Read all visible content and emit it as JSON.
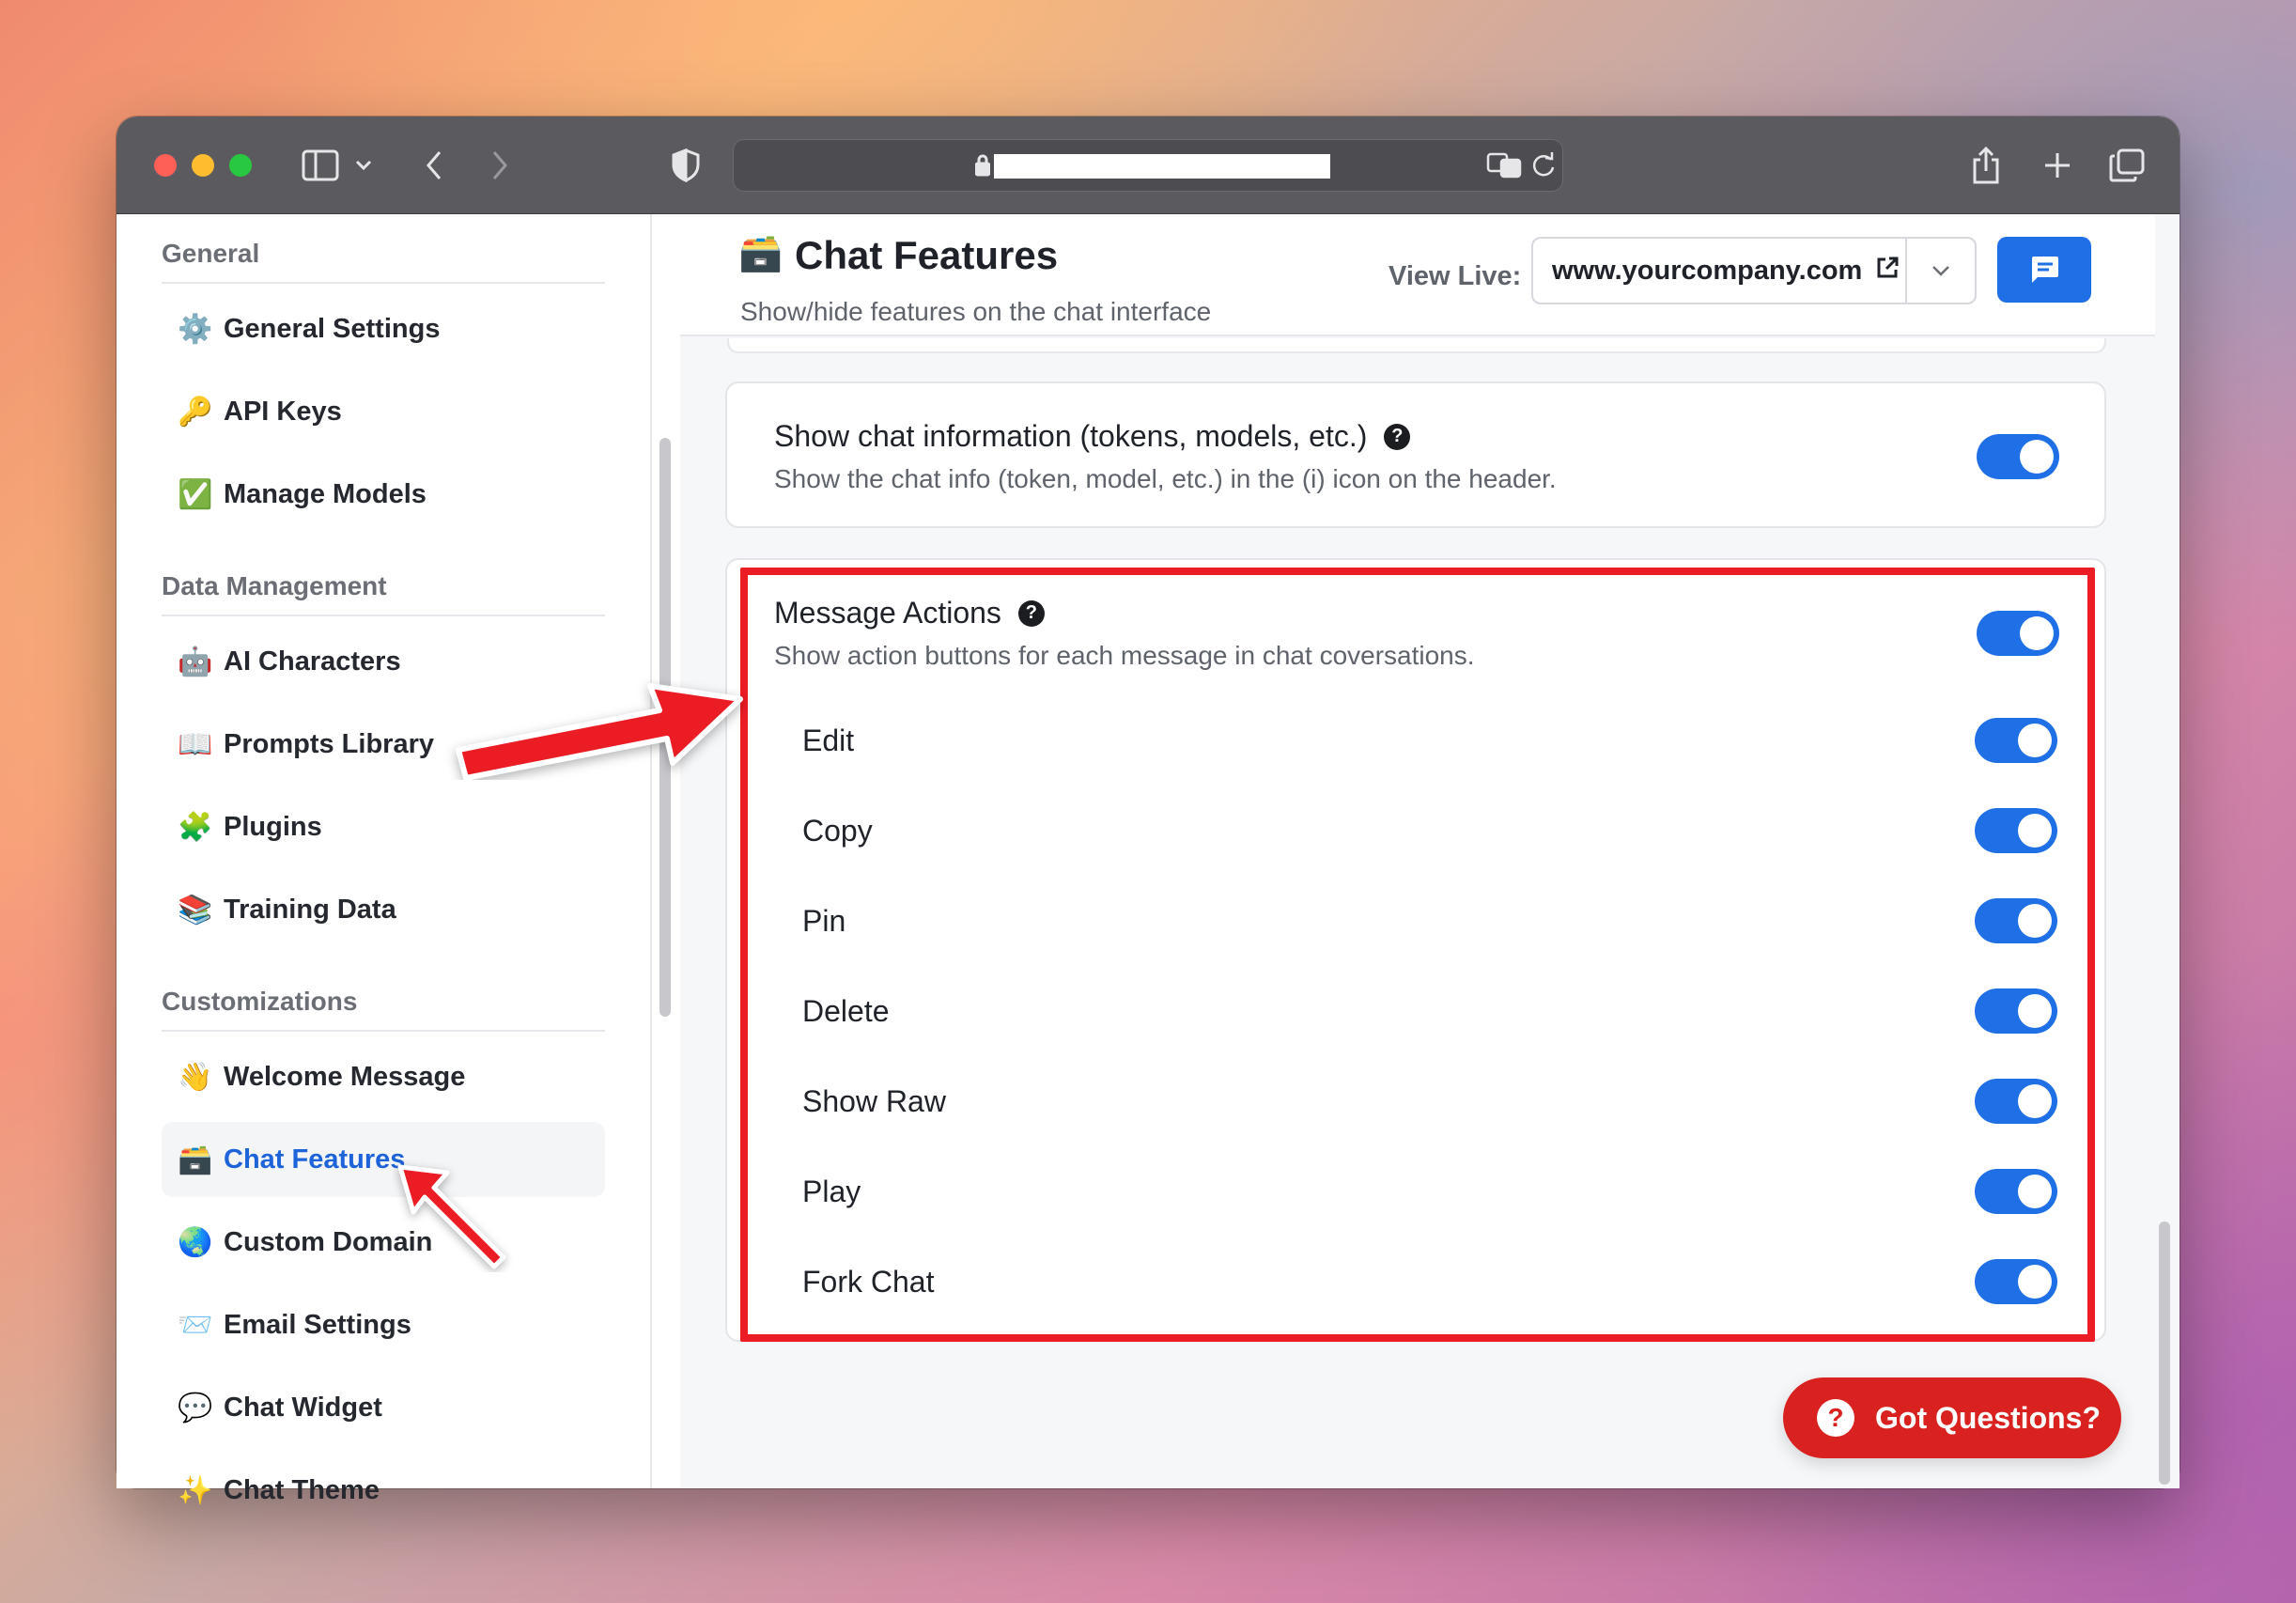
{
  "browser": {
    "icons": [
      "sidebar-toggle-icon",
      "chevron-down-icon",
      "back-icon",
      "forward-icon",
      "shield-icon",
      "lock-icon",
      "translate-icon",
      "reload-icon",
      "share-icon",
      "plus-icon",
      "tabs-icon"
    ]
  },
  "sidebar": {
    "sections": [
      {
        "title": "General",
        "items": [
          {
            "emoji": "⚙️",
            "label": "General Settings"
          },
          {
            "emoji": "🔑",
            "label": "API Keys"
          },
          {
            "emoji": "✅",
            "label": "Manage Models"
          }
        ]
      },
      {
        "title": "Data Management",
        "items": [
          {
            "emoji": "🤖",
            "label": "AI Characters"
          },
          {
            "emoji": "📖",
            "label": "Prompts Library"
          },
          {
            "emoji": "🧩",
            "label": "Plugins"
          },
          {
            "emoji": "📚",
            "label": "Training Data"
          }
        ]
      },
      {
        "title": "Customizations",
        "items": [
          {
            "emoji": "👋",
            "label": "Welcome Message"
          },
          {
            "emoji": "🗃️",
            "label": "Chat Features",
            "active": true
          },
          {
            "emoji": "🌏",
            "label": "Custom Domain"
          },
          {
            "emoji": "📨",
            "label": "Email Settings"
          },
          {
            "emoji": "💬",
            "label": "Chat Widget"
          },
          {
            "emoji": "✨",
            "label": "Chat Theme"
          }
        ]
      }
    ]
  },
  "header": {
    "title_emoji": "🗃️",
    "title": "Chat Features",
    "subtitle": "Show/hide features on the chat interface",
    "view_live_label": "View Live:",
    "domain": "www.yourcompany.com"
  },
  "chat_info": {
    "title": "Show chat information (tokens, models, etc.)",
    "description": "Show the chat info (token, model, etc.) in the (i) icon on the header.",
    "enabled": true
  },
  "message_actions": {
    "title": "Message Actions",
    "description": "Show action buttons for each message in chat coversations.",
    "enabled": true,
    "actions": [
      {
        "label": "Edit",
        "enabled": true
      },
      {
        "label": "Copy",
        "enabled": true
      },
      {
        "label": "Pin",
        "enabled": true
      },
      {
        "label": "Delete",
        "enabled": true
      },
      {
        "label": "Show Raw",
        "enabled": true
      },
      {
        "label": "Play",
        "enabled": true
      },
      {
        "label": "Fork Chat",
        "enabled": true
      }
    ]
  },
  "help_button": {
    "label": "Got Questions?"
  },
  "colors": {
    "accent": "#1f6fe6",
    "highlight": "#ec1c24",
    "help_button": "#d9221f",
    "active_link": "#1d63d9"
  }
}
